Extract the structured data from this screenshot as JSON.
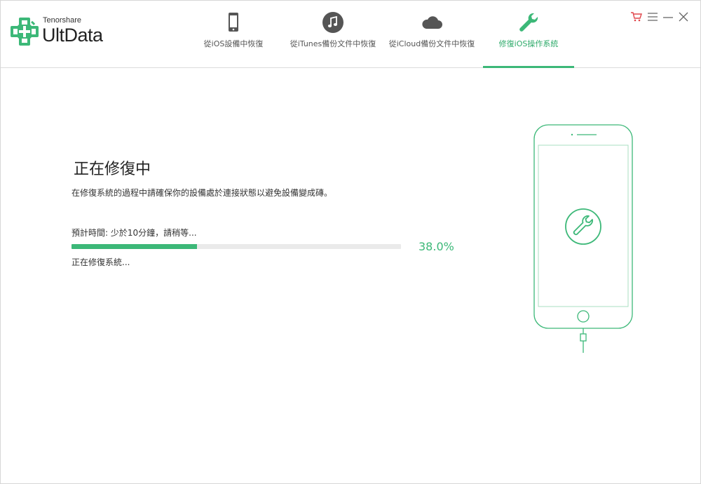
{
  "app": {
    "brand": "Tenorshare",
    "product": "UltData"
  },
  "tabs": [
    {
      "label": "從iOS設備中恢復",
      "icon": "phone-icon",
      "active": false
    },
    {
      "label": "從iTunes備份文件中恢復",
      "icon": "music-note-icon",
      "active": false
    },
    {
      "label": "從iCloud備份文件中恢復",
      "icon": "cloud-icon",
      "active": false
    },
    {
      "label": "修復iOS操作系統",
      "icon": "wrench-icon",
      "active": true
    }
  ],
  "window_controls": [
    {
      "icon": "cart-icon"
    },
    {
      "icon": "menu-icon"
    },
    {
      "icon": "minimize-icon"
    },
    {
      "icon": "close-icon"
    }
  ],
  "repair": {
    "title": "正在修復中",
    "subtitle": "在修復系統的過程中請確保你的設備處於連接狀態以避免設備變成磚。",
    "eta": "預計時間: 少於10分鐘，請稍等...",
    "progress_value": 38.0,
    "progress_label": "38.0%",
    "status": "正在修復系統..."
  },
  "colors": {
    "accent": "#3cb878",
    "accent_text": "#2eaa6a",
    "cart": "#e0474c",
    "icon_gray": "#555555"
  }
}
